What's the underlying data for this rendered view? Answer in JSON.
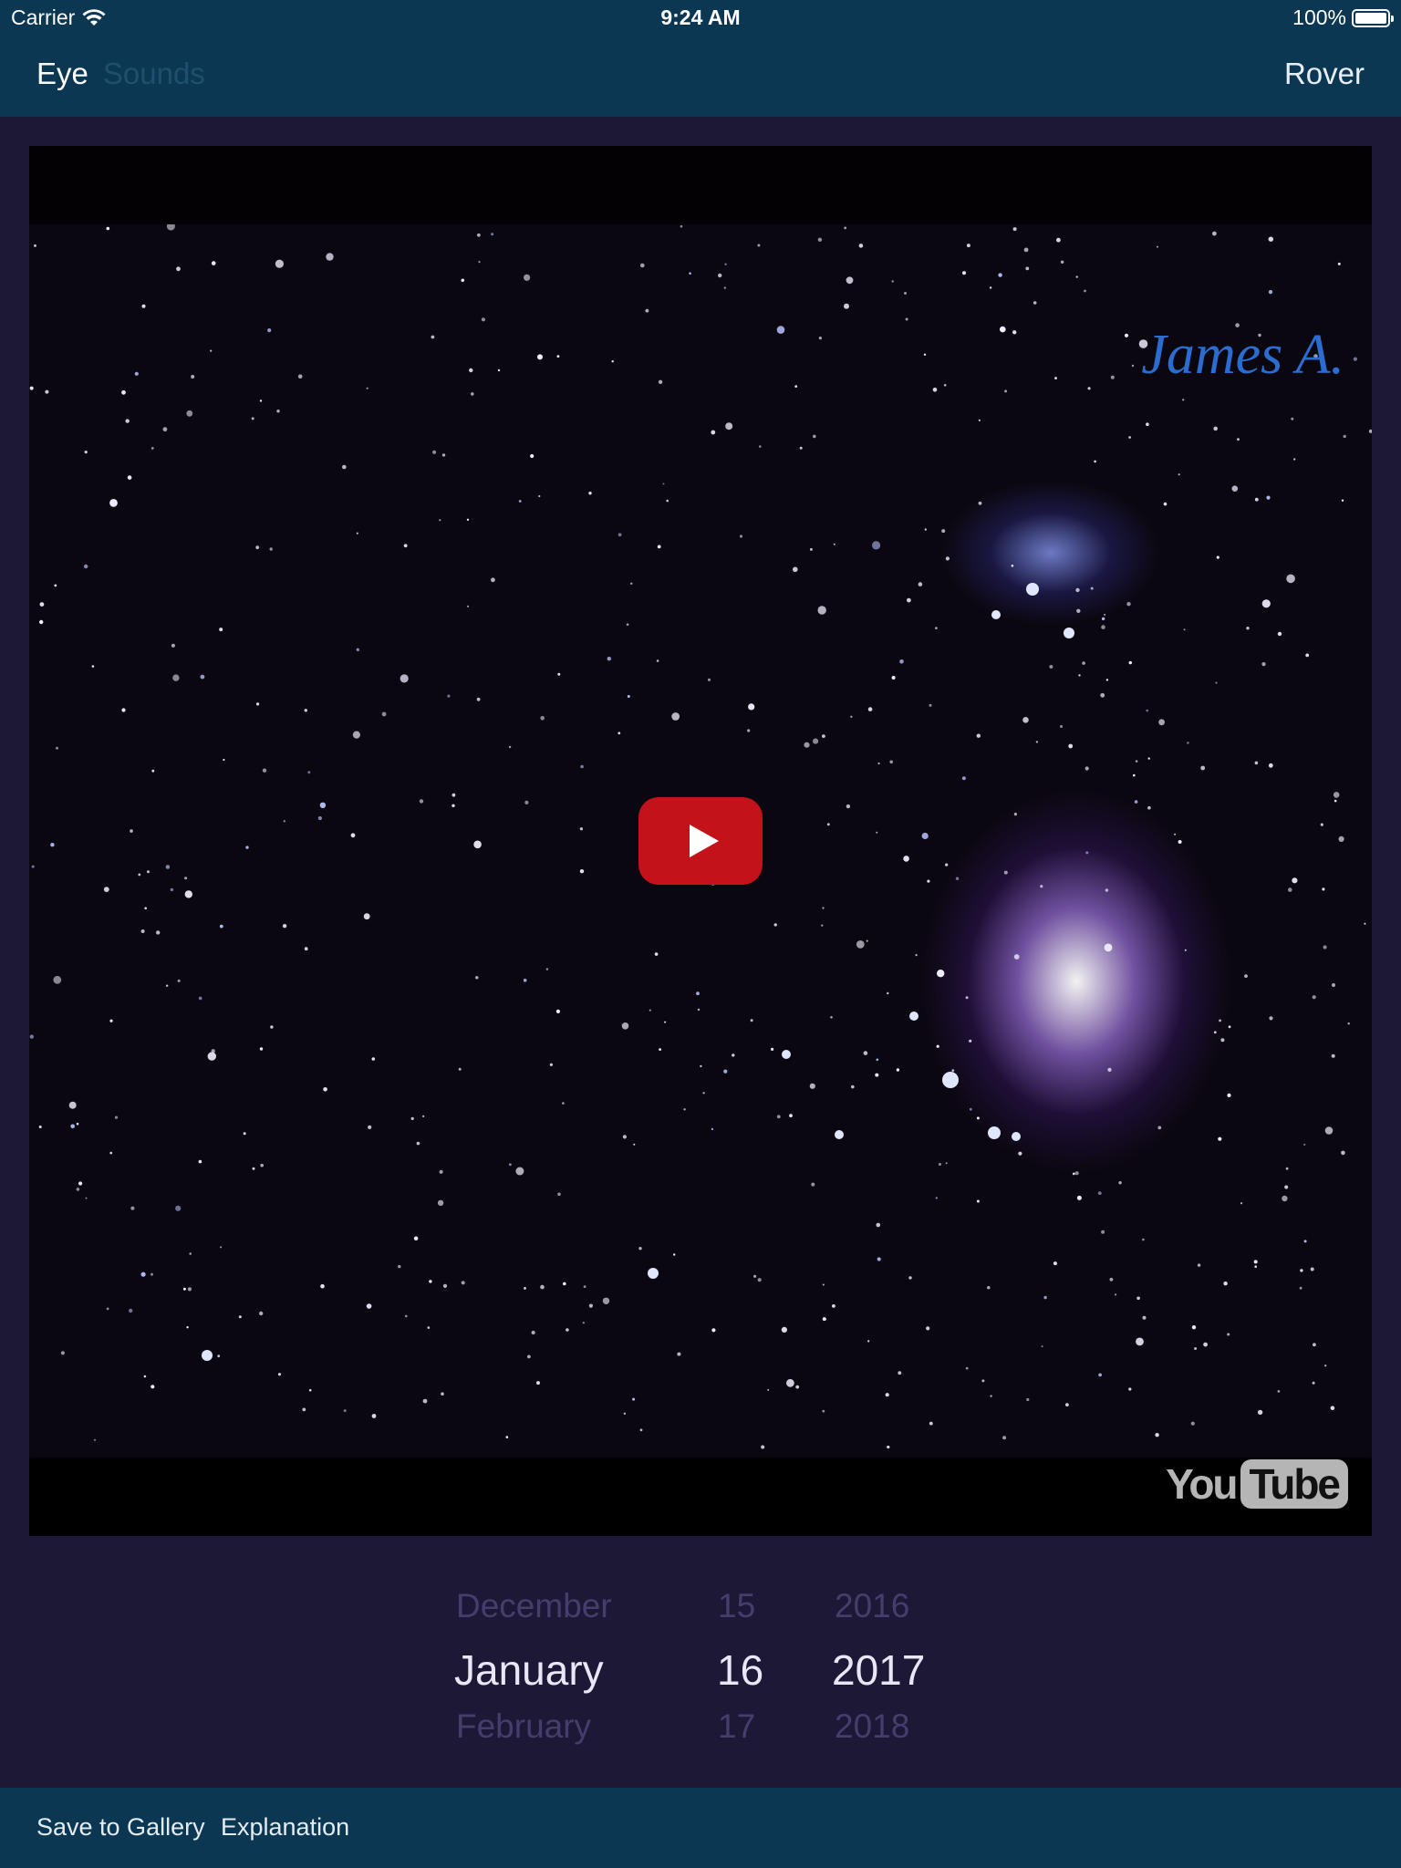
{
  "status_bar": {
    "carrier": "Carrier",
    "time": "9:24 AM",
    "battery": "100%"
  },
  "nav": {
    "left_label": "Eye",
    "left_secondary": "Sounds",
    "right_label": "Rover"
  },
  "video": {
    "credit": "James A.",
    "provider": "YouTube",
    "provider_you": "You",
    "provider_tube": "Tube",
    "play_icon": "play-icon"
  },
  "date_picker": {
    "month": {
      "prev": "December",
      "selected": "January",
      "next": "February"
    },
    "day": {
      "prev": "15",
      "selected": "16",
      "next": "17"
    },
    "year": {
      "prev": "2016",
      "selected": "2017",
      "next": "2018"
    }
  },
  "toolbar": {
    "save_label": "Save to Gallery",
    "explanation_label": "Explanation"
  },
  "colors": {
    "bar": "#0b3753",
    "background": "#1c1836",
    "play": "#c4121b",
    "credit": "#2a6cd0"
  }
}
